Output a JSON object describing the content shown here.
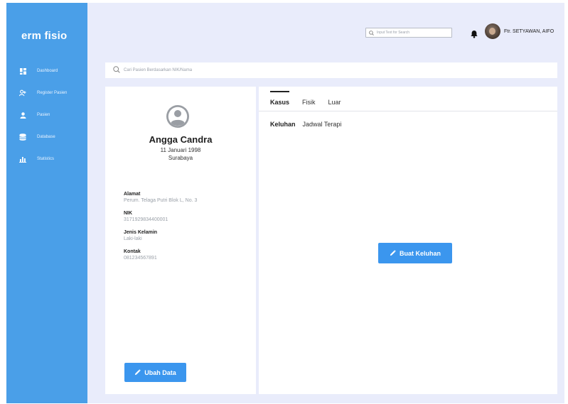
{
  "app": {
    "brand": "erm fisio"
  },
  "sidebar": {
    "items": [
      {
        "label": "Dashboard",
        "icon": "dashboard-icon"
      },
      {
        "label": "Register Pasien",
        "icon": "add-user-icon"
      },
      {
        "label": "Pasien",
        "icon": "user-icon"
      },
      {
        "label": "Database",
        "icon": "database-icon"
      },
      {
        "label": "Statistics",
        "icon": "bar-chart-icon"
      }
    ]
  },
  "header": {
    "search_placeholder": "Input Text for Search",
    "user_name": "Ftr. SETYAWAN, AIFO"
  },
  "patient_search": {
    "placeholder": "Cari Pasien Berdasarkan NIK/Nama"
  },
  "profile": {
    "name": "Angga Candra",
    "dob": "11 Januari 1998",
    "city": "Surabaya",
    "fields": [
      {
        "label": "Alamat",
        "value": "Perum. Telaga Putri Blok L, No. 3"
      },
      {
        "label": "NIK",
        "value": "3171929834400001"
      },
      {
        "label": "Jenis Kelamin",
        "value": "Laki-laki"
      },
      {
        "label": "Kontak",
        "value": "081234567891"
      }
    ],
    "edit_button": "Ubah Data"
  },
  "main": {
    "tabs": [
      "Kasus",
      "Fisik",
      "Luar"
    ],
    "subtabs": [
      "Keluhan",
      "Jadwal Terapi"
    ],
    "create_button": "Buat Keluhan"
  },
  "colors": {
    "sidebar": "#4a9fe8",
    "accent": "#3b96ee",
    "background": "#e9ecfb"
  }
}
